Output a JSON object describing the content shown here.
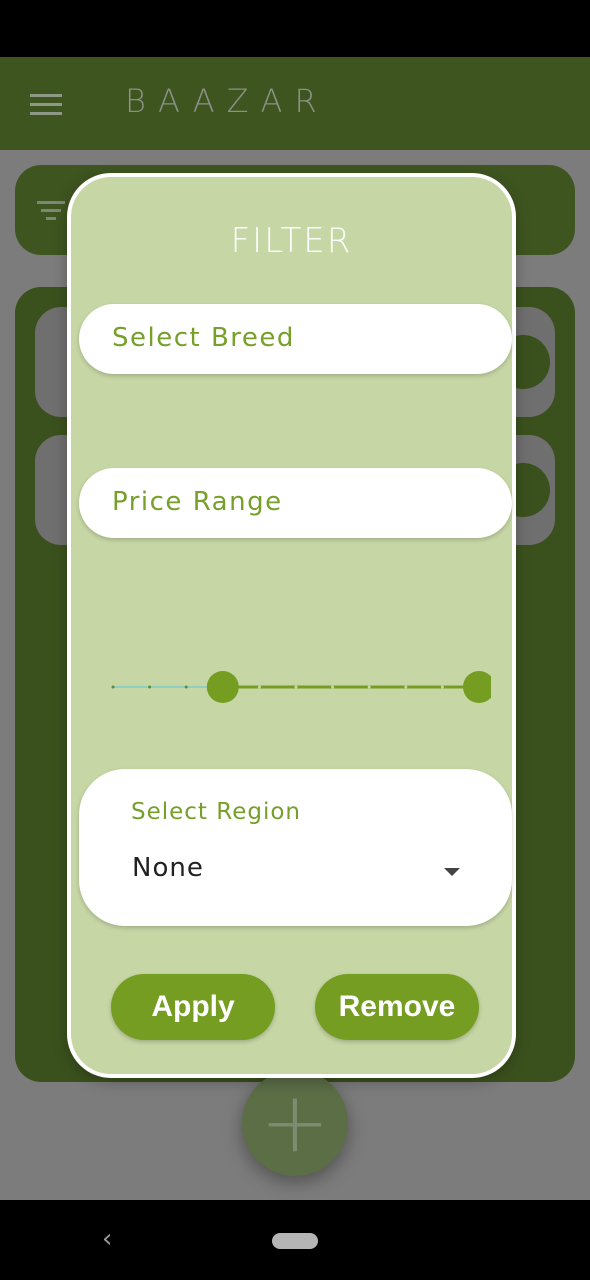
{
  "app": {
    "title": "BAAZAR",
    "menu_icon": "hamburger-menu-icon",
    "filter_icon": "filter-icon",
    "fab_icon": "plus-icon"
  },
  "filter_dialog": {
    "title": "FILTER",
    "breed_field": {
      "placeholder": "Select Breed"
    },
    "price_field": {
      "placeholder": "Price Range"
    },
    "price_slider": {
      "range_fraction": [
        0.3,
        1.0
      ],
      "divisions": 10
    },
    "region": {
      "label": "Select Region",
      "value": "None"
    },
    "apply_label": "Apply",
    "remove_label": "Remove"
  },
  "colors": {
    "app_bar": "#3f5520",
    "dialog_bg": "#c6d6a4",
    "accent_green": "#759d22",
    "field_text": "#76a02a"
  },
  "system_nav": {
    "back_icon": "back-chevron-icon",
    "home_icon": "home-pill-icon"
  }
}
